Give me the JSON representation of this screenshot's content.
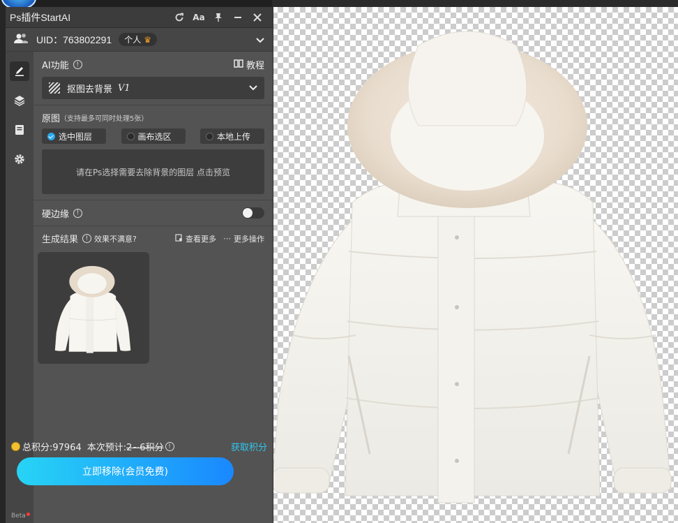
{
  "window": {
    "title": "Ps插件StartAI"
  },
  "user": {
    "uid_label": "UID：763802291",
    "plan_badge": "个人"
  },
  "ai_function": {
    "label": "AI功能",
    "tutorial_label": "教程",
    "selected_tool": "抠图去背景",
    "tool_version": "V1"
  },
  "source_image": {
    "label": "原图",
    "hint": "（支持最多可同时处理5张）",
    "options": [
      "选中图层",
      "画布选区",
      "本地上传"
    ],
    "selected_index": 0,
    "dropzone_text": "请在Ps选择需要去除背景的图层 点击预览"
  },
  "hard_edge": {
    "label": "硬边缘",
    "enabled": false
  },
  "result": {
    "label": "生成结果",
    "not_satisfied": "效果不满意?",
    "view_more": "查看更多",
    "more_actions": "更多操作"
  },
  "footer": {
    "total_points": "总积分:97964",
    "estimate_label": "本次预计:",
    "estimate_value": "2~6积分",
    "get_points": "获取积分",
    "cta_label": "立即移除(会员免费)",
    "beta": "Beta"
  },
  "colors": {
    "accent": "#2fc7f0",
    "cta_start": "#27d4f5",
    "cta_end": "#1a88ff",
    "panel_bg": "#535353"
  }
}
